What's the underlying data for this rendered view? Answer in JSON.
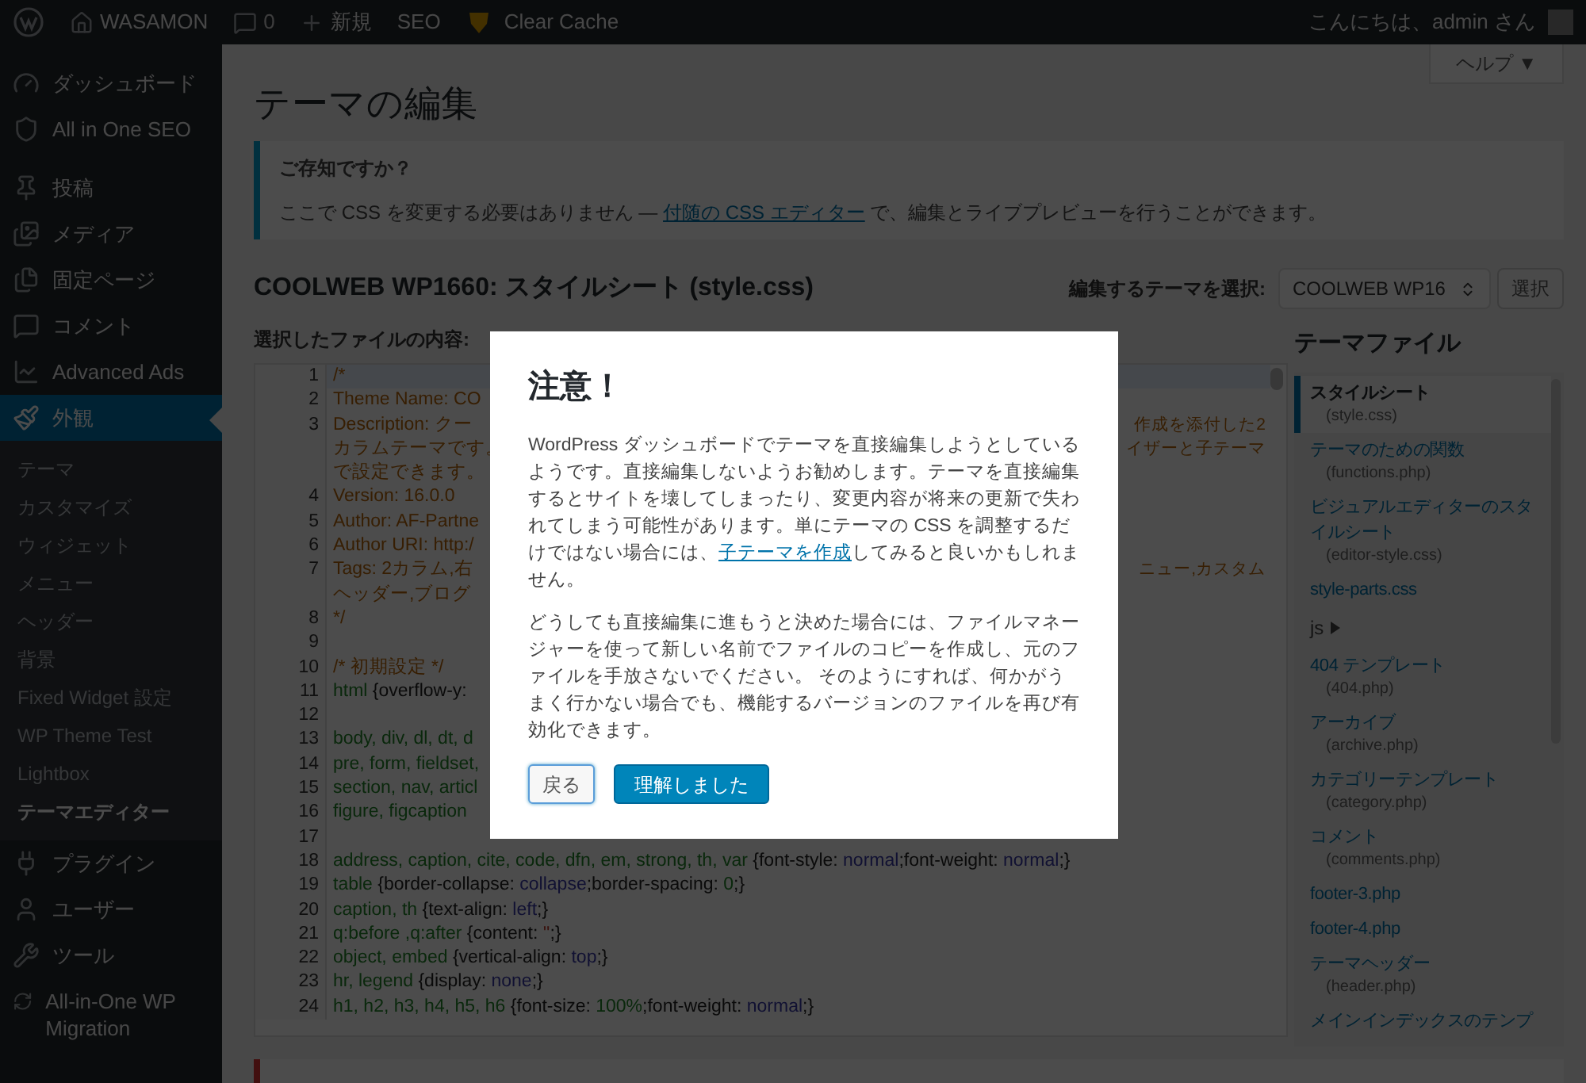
{
  "admin_bar": {
    "site": "WASAMON",
    "comments": "0",
    "new": "新規",
    "seo": "SEO",
    "cache": "Clear Cache",
    "greeting": "こんにちは、admin さん"
  },
  "sidebar": {
    "items": [
      {
        "label": "ダッシュボード",
        "selected": false
      },
      {
        "label": "All in One SEO",
        "selected": false
      },
      {
        "label": "投稿",
        "selected": false
      },
      {
        "label": "メディア",
        "selected": false
      },
      {
        "label": "固定ページ",
        "selected": false
      },
      {
        "label": "コメント",
        "selected": false
      },
      {
        "label": "Advanced Ads",
        "selected": false
      },
      {
        "label": "外観",
        "selected": true,
        "children": [
          {
            "label": "テーマ",
            "selected": false
          },
          {
            "label": "カスタマイズ",
            "selected": false
          },
          {
            "label": "ウィジェット",
            "selected": false
          },
          {
            "label": "メニュー",
            "selected": false
          },
          {
            "label": "ヘッダー",
            "selected": false
          },
          {
            "label": "背景",
            "selected": false
          },
          {
            "label": "Fixed Widget 設定",
            "selected": false
          },
          {
            "label": "WP Theme Test",
            "selected": false
          },
          {
            "label": "Lightbox",
            "selected": false
          },
          {
            "label": "テーマエディター",
            "selected": true
          }
        ]
      },
      {
        "label": "プラグイン",
        "selected": false
      },
      {
        "label": "ユーザー",
        "selected": false
      },
      {
        "label": "ツール",
        "selected": false
      },
      {
        "label": "All-in-One WP Migration",
        "selected": false
      }
    ]
  },
  "help_button": "ヘルプ ▼",
  "page_title": "テーマの編集",
  "notice": {
    "title": "ご存知ですか？",
    "before": "ここで CSS を変更する必要はありません — ",
    "link": "付随の CSS エディター",
    "after": " で、編集とライブプレビューを行うことができます。"
  },
  "file_heading": "COOLWEB WP1660: スタイルシート (style.css)",
  "theme_select": {
    "label": "編集するテーマを選択:",
    "value": "COOLWEB WP16",
    "button": "選択"
  },
  "editor": {
    "label": "選択したファイルの内容:",
    "rows": [
      {
        "number": "1",
        "parts": [
          {
            "kind": "comment",
            "text": "/*"
          }
        ]
      },
      {
        "number": "2",
        "parts": [
          {
            "kind": "comment",
            "text": "Theme Name: CO"
          }
        ]
      },
      {
        "number": "3",
        "parts": [
          {
            "kind": "comment",
            "text": "Description: クー"
          }
        ],
        "tail": "作成を添付した2"
      },
      {
        "parts": [
          {
            "kind": "comment",
            "text": "カラムテーマです。"
          }
        ],
        "tail": "イザーと子テーマ"
      },
      {
        "parts": [
          {
            "kind": "comment",
            "text": "で設定できます。"
          }
        ]
      },
      {
        "number": "4",
        "parts": [
          {
            "kind": "comment",
            "text": "Version: 16.0.0"
          }
        ]
      },
      {
        "number": "5",
        "parts": [
          {
            "kind": "comment",
            "text": "Author: AF-Partne"
          }
        ]
      },
      {
        "number": "6",
        "parts": [
          {
            "kind": "comment",
            "text": "Author URI: http:/"
          }
        ]
      },
      {
        "number": "7",
        "parts": [
          {
            "kind": "comment",
            "text": "Tags: 2カラム,右"
          }
        ],
        "tail": "ニュー,カスタム"
      },
      {
        "parts": [
          {
            "kind": "comment",
            "text": "ヘッダー,ブログ"
          }
        ]
      },
      {
        "number": "8",
        "parts": [
          {
            "kind": "comment",
            "text": "*/"
          }
        ]
      },
      {
        "number": "9",
        "parts": []
      },
      {
        "number": "10",
        "parts": [
          {
            "kind": "comment",
            "text": "/* 初期設定 */"
          }
        ]
      },
      {
        "number": "11",
        "parts": [
          {
            "kind": "selector",
            "text": "html "
          },
          {
            "kind": "plain",
            "text": "{overflow-y:"
          }
        ]
      },
      {
        "number": "12",
        "parts": []
      },
      {
        "number": "13",
        "parts": [
          {
            "kind": "selector",
            "text": "body, div, dl, dt, d"
          }
        ]
      },
      {
        "number": "14",
        "parts": [
          {
            "kind": "selector",
            "text": "pre, form, fieldset,"
          }
        ]
      },
      {
        "number": "15",
        "parts": [
          {
            "kind": "selector",
            "text": "section, nav, articl"
          }
        ]
      },
      {
        "number": "16",
        "parts": [
          {
            "kind": "selector",
            "text": "figure, figcaption"
          }
        ]
      },
      {
        "number": "17",
        "parts": []
      },
      {
        "number": "18",
        "parts": [
          {
            "kind": "selector",
            "text": "address, caption, cite, code, dfn, em, strong, th, var "
          },
          {
            "kind": "plain",
            "text": "{font-style: "
          },
          {
            "kind": "value",
            "text": "normal"
          },
          {
            "kind": "plain",
            "text": ";font-weight: "
          },
          {
            "kind": "value",
            "text": "normal"
          },
          {
            "kind": "plain",
            "text": ";}"
          }
        ]
      },
      {
        "number": "19",
        "parts": [
          {
            "kind": "selector",
            "text": "table "
          },
          {
            "kind": "plain",
            "text": "{border-collapse: "
          },
          {
            "kind": "value",
            "text": "collapse"
          },
          {
            "kind": "plain",
            "text": ";border-spacing: "
          },
          {
            "kind": "number",
            "text": "0"
          },
          {
            "kind": "plain",
            "text": ";}"
          }
        ]
      },
      {
        "number": "20",
        "parts": [
          {
            "kind": "selector",
            "text": "caption, th "
          },
          {
            "kind": "plain",
            "text": "{text-align: "
          },
          {
            "kind": "value",
            "text": "left"
          },
          {
            "kind": "plain",
            "text": ";}"
          }
        ]
      },
      {
        "number": "21",
        "parts": [
          {
            "kind": "selector",
            "text": "q:before ,q:after "
          },
          {
            "kind": "plain",
            "text": "{content: "
          },
          {
            "kind": "string",
            "text": "''"
          },
          {
            "kind": "plain",
            "text": ";}"
          }
        ]
      },
      {
        "number": "22",
        "parts": [
          {
            "kind": "selector",
            "text": "object, embed "
          },
          {
            "kind": "plain",
            "text": "{vertical-align: "
          },
          {
            "kind": "value",
            "text": "top"
          },
          {
            "kind": "plain",
            "text": ";}"
          }
        ]
      },
      {
        "number": "23",
        "parts": [
          {
            "kind": "selector",
            "text": "hr, legend "
          },
          {
            "kind": "plain",
            "text": "{display: "
          },
          {
            "kind": "value",
            "text": "none"
          },
          {
            "kind": "plain",
            "text": ";}"
          }
        ]
      },
      {
        "number": "24",
        "parts": [
          {
            "kind": "selector",
            "text": "h1, h2, h3, h4, h5, h6 "
          },
          {
            "kind": "plain",
            "text": "{font-size: "
          },
          {
            "kind": "number",
            "text": "100%"
          },
          {
            "kind": "plain",
            "text": ";font-weight: "
          },
          {
            "kind": "value",
            "text": "normal"
          },
          {
            "kind": "plain",
            "text": ";}"
          }
        ]
      }
    ]
  },
  "theme_files": {
    "title": "テーマファイル",
    "items": [
      {
        "kind": "file",
        "name": "スタイルシート",
        "file": "(style.css)",
        "selected": true
      },
      {
        "kind": "file",
        "name": "テーマのための関数",
        "file": "(functions.php)",
        "selected": false
      },
      {
        "kind": "file",
        "name": "ビジュアルエディターのスタイルシート",
        "file": "(editor-style.css)",
        "selected": false
      },
      {
        "kind": "file",
        "name": "style-parts.css",
        "selected": false
      },
      {
        "kind": "folder",
        "name": "js",
        "expanded": false
      },
      {
        "kind": "file",
        "name": "404 テンプレート",
        "file": "(404.php)",
        "selected": false
      },
      {
        "kind": "file",
        "name": "アーカイブ",
        "file": "(archive.php)",
        "selected": false
      },
      {
        "kind": "file",
        "name": "カテゴリーテンプレート",
        "file": "(category.php)",
        "selected": false
      },
      {
        "kind": "file",
        "name": "コメント",
        "file": "(comments.php)",
        "selected": false
      },
      {
        "kind": "file",
        "name": "footer-3.php",
        "selected": false
      },
      {
        "kind": "file",
        "name": "footer-4.php",
        "selected": false
      },
      {
        "kind": "file",
        "name": "テーマヘッダー",
        "file": "(header.php)",
        "selected": false
      },
      {
        "kind": "file",
        "name": "メインインデックスのテンプ",
        "selected": false
      }
    ]
  },
  "modal": {
    "title": "注意！",
    "paragraph_1": {
      "before": "WordPress ダッシュボードでテーマを直接編集しようとしているようです。直接編集しないようお勧めします。テーマを直接編集するとサイトを壊してしまったり、変更内容が将来の更新で失われてしまう可能性があります。単にテーマの CSS を調整するだけではない場合には、",
      "link": "子テーマを作成",
      "after": "してみると良いかもしれません。"
    },
    "paragraph_2": "どうしても直接編集に進もうと決めた場合には、ファイルマネージャーを使って新しい名前でファイルのコピーを作成し、元のファイルを手放さないでください。 そのようにすれば、何かがうまく行かない場合でも、機能するバージョンのファイルを再び有効化できます。",
    "buttons": [
      {
        "label": "戻る",
        "kind": "secondary"
      },
      {
        "label": "理解しました",
        "kind": "primary"
      }
    ]
  }
}
